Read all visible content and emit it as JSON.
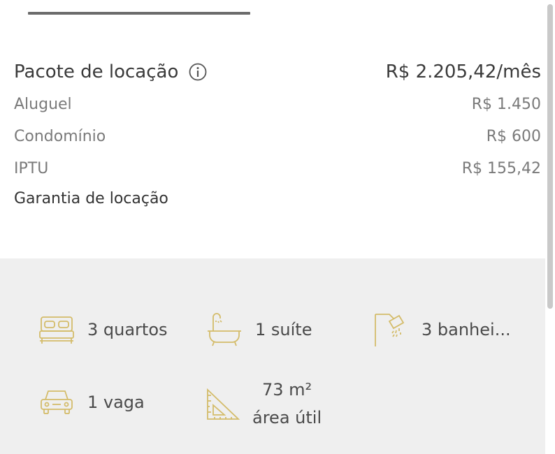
{
  "package": {
    "title": "Pacote de locação",
    "total": "R$ 2.205,42/mês",
    "items": [
      {
        "label": "Aluguel",
        "value": "R$ 1.450"
      },
      {
        "label": "Condomínio",
        "value": "R$ 600"
      },
      {
        "label": "IPTU",
        "value": "R$ 155,42"
      }
    ],
    "guarantee_label": "Garantia de locação"
  },
  "features": {
    "bedrooms": {
      "text": "3 quartos",
      "icon": "bed-icon"
    },
    "suites": {
      "text": "1 suíte",
      "icon": "bathtub-icon"
    },
    "bathrooms": {
      "text": "3 banhei...",
      "icon": "shower-icon"
    },
    "parking": {
      "text": "1 vaga",
      "icon": "car-icon"
    },
    "area": {
      "value": "73 m²",
      "label": "área útil",
      "icon": "ruler-triangle-icon"
    }
  },
  "colors": {
    "icon_gold": "#d4bc6a",
    "feature_background": "#efefef"
  }
}
